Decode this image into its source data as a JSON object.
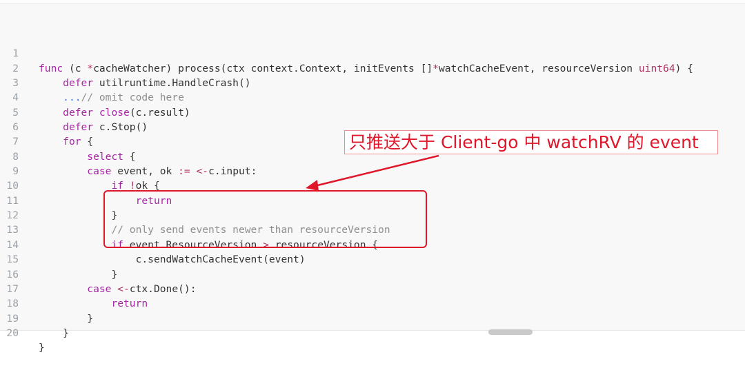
{
  "code": {
    "line_numbers": [
      "1",
      "2",
      "3",
      "4",
      "5",
      "6",
      "7",
      "8",
      "9",
      "10",
      "11",
      "12",
      "13",
      "14",
      "15",
      "16",
      "17",
      "18",
      "19",
      "20"
    ],
    "l1": {
      "kw_func": "func",
      "p1": " (c ",
      "star": "*",
      "p2": "cacheWatcher) process(ctx context.Context, initEvents []",
      "star2": "*",
      "p3": "watchCacheEvent, resourceVersion ",
      "type": "uint64",
      ")": ") {"
    },
    "l2": {
      "kw": "defer",
      "rest": " utilruntime.HandleCrash()"
    },
    "l3": {
      "dots": "...",
      "comment": "// omit code here"
    },
    "l4": {
      "kw": "defer",
      "rest1": " ",
      "fn": "close",
      "rest2": "(c.result)"
    },
    "l5": {
      "kw": "defer",
      "rest": " c.Stop()"
    },
    "l6": {
      "kw": "for",
      "rest": " {"
    },
    "l7": {
      "kw": "select",
      "rest": " {"
    },
    "l8": {
      "kw": "case",
      "rest1": " event, ok ",
      "op": ":=",
      "rest2": " ",
      "op2": "<-",
      "rest3": "c.input:"
    },
    "l9": {
      "kw": "if",
      "op": " !",
      "rest": "ok {"
    },
    "l10": {
      "kw": "return"
    },
    "l11": {
      "rest": "}"
    },
    "l12": {
      "comment": "// only send events newer than resourceVersion"
    },
    "l13": {
      "kw": "if",
      "rest1": " event.ResourceVersion ",
      "op": ">",
      "rest2": " resourceVersion {"
    },
    "l14": {
      "rest": "c.sendWatchCacheEvent(event)"
    },
    "l15": {
      "rest": "}"
    },
    "l16": {
      "kw": "case",
      "rest1": " ",
      "op": "<-",
      "rest2": "ctx.Done():"
    },
    "l17": {
      "kw": "return"
    },
    "l18": {
      "rest": "}"
    },
    "l19": {
      "rest": "}"
    },
    "l20": {
      "rest": "}"
    }
  },
  "annotation": {
    "callout_text": "只推送大于 Client-go 中 watchRV 的 event"
  },
  "colors": {
    "accent_red": "#e0162b",
    "keyword": "#a626a4",
    "comment": "#8f8f8f",
    "type": "#b03060"
  }
}
